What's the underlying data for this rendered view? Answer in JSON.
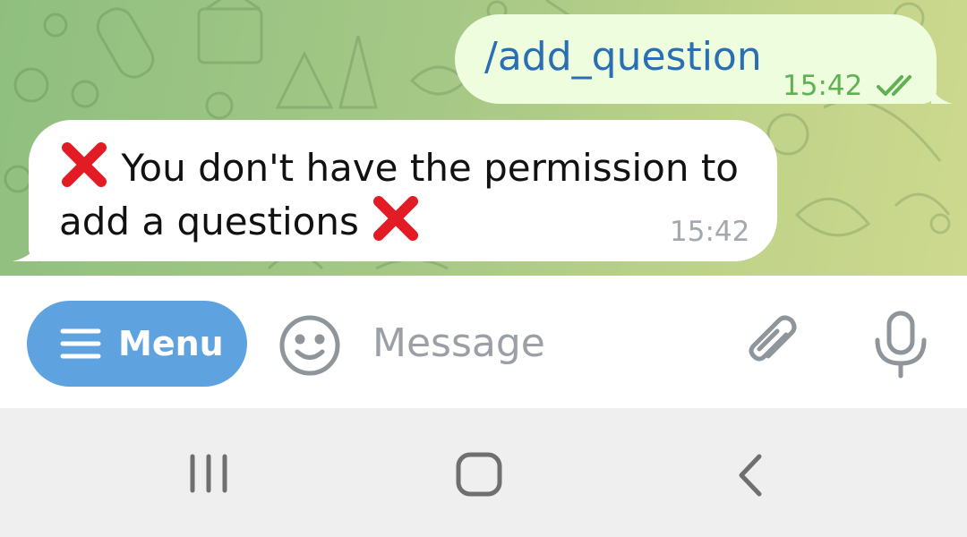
{
  "chat": {
    "outgoing_message": {
      "text": "/add_question",
      "time": "15:42",
      "status_icon": "double-check-icon"
    },
    "incoming_message": {
      "prefix_icon": "cross-mark-emoji",
      "text": "You don't have the permission to add a questions",
      "suffix_icon": "cross-mark-emoji",
      "time": "15:42"
    }
  },
  "input_bar": {
    "menu_label": "Menu",
    "message_placeholder": "Message",
    "icons": [
      "hamburger-icon",
      "emoji-icon",
      "paperclip-icon",
      "microphone-icon"
    ]
  },
  "nav_bar": {
    "icons": [
      "recents-icon",
      "home-icon",
      "back-icon"
    ]
  },
  "colors": {
    "outgoing_bubble": "#effddf",
    "command_link": "#2a6fb3",
    "read_checks": "#5fb152",
    "menu_button": "#5ea3df",
    "cross_mark": "#e21b24"
  }
}
